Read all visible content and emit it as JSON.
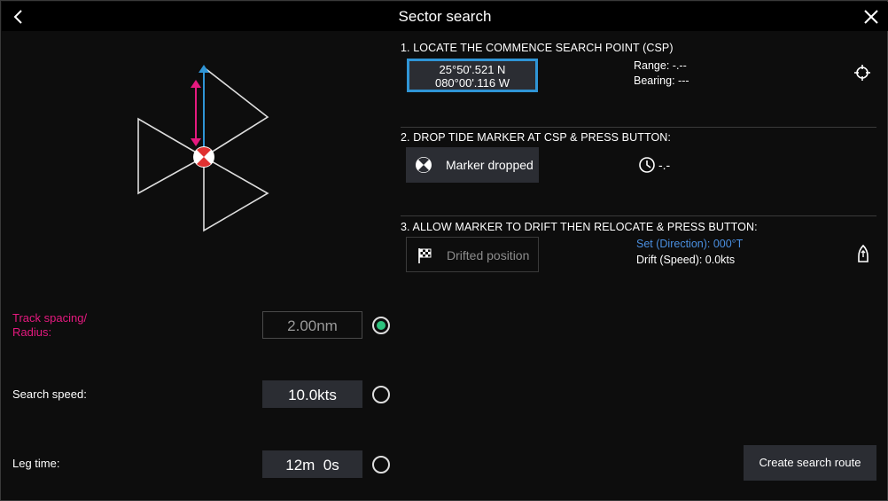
{
  "header": {
    "title": "Sector search",
    "back_icon": "chevron-left-icon",
    "close_icon": "close-icon"
  },
  "settings": {
    "track_spacing": {
      "label": "Track spacing/\nRadius:",
      "value": "2.00nm",
      "selected": true
    },
    "search_speed": {
      "label": "Search speed:",
      "value": "10.0kts",
      "selected": false
    },
    "leg_time": {
      "label": "Leg time:",
      "value": "12m  0s",
      "selected": false
    }
  },
  "step1": {
    "heading": "1. LOCATE THE COMMENCE SEARCH POINT (CSP)",
    "lat": "25°50'.521 N",
    "lon": "080°00'.116 W",
    "range": "Range: -.--",
    "bearing": "Bearing: ---",
    "icon": "crosshair-icon"
  },
  "step2": {
    "heading": "2. DROP TIDE MARKER AT CSP & PRESS BUTTON:",
    "button_label": "Marker dropped",
    "button_icon": "marker-buoy-icon",
    "timer": "-.-",
    "timer_icon": "clock-icon"
  },
  "step3": {
    "heading": "3. ALLOW MARKER TO DRIFT THEN RELOCATE & PRESS BUTTON:",
    "button_label": "Drifted position",
    "button_icon": "checkered-flag-icon",
    "set_direction": "Set (Direction): 000°T",
    "drift_speed": "Drift (Speed): 0.0kts",
    "icon": "vessel-heading-icon"
  },
  "actions": {
    "create_route": "Create search route"
  },
  "colors": {
    "accent_blue": "#2f95d6",
    "pink": "#e5197f",
    "green": "#2ec27e",
    "set_blue": "#4a8fe0"
  }
}
